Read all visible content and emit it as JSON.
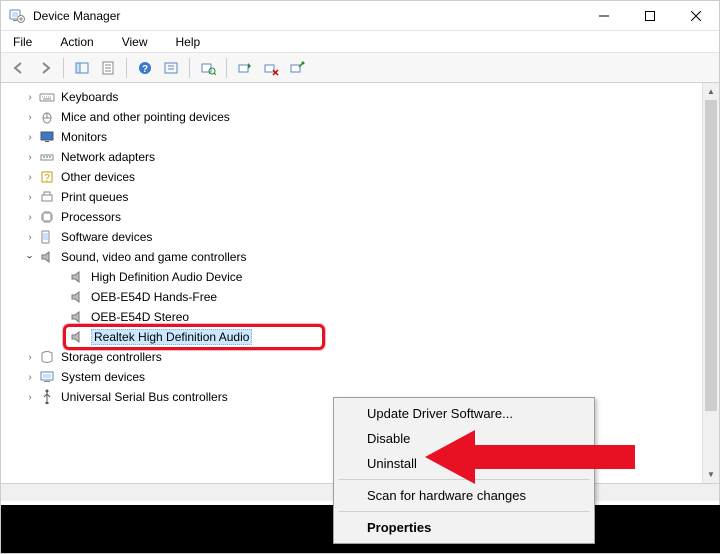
{
  "window": {
    "title": "Device Manager"
  },
  "menubar": {
    "file": "File",
    "action": "Action",
    "view": "View",
    "help": "Help"
  },
  "tree": {
    "keyboards": "Keyboards",
    "mice": "Mice and other pointing devices",
    "monitors": "Monitors",
    "network": "Network adapters",
    "other": "Other devices",
    "print": "Print queues",
    "processors": "Processors",
    "software": "Software devices",
    "sound": "Sound, video and game controllers",
    "sound_children": {
      "hd_audio": "High Definition Audio Device",
      "oeb_hf": "OEB-E54D Hands-Free",
      "oeb_stereo": "OEB-E54D Stereo",
      "realtek": "Realtek High Definition Audio"
    },
    "storage": "Storage controllers",
    "system": "System devices",
    "usb": "Universal Serial Bus controllers"
  },
  "contextmenu": {
    "update": "Update Driver Software...",
    "disable": "Disable",
    "uninstall": "Uninstall",
    "scan": "Scan for hardware changes",
    "properties": "Properties"
  }
}
